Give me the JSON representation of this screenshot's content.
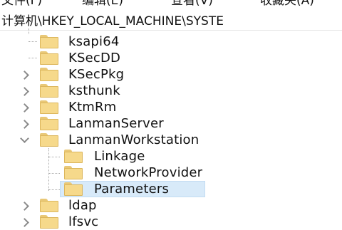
{
  "menubar": {
    "items": [
      "文件(F)",
      "编辑(E)",
      "查看(V)",
      "收藏夹(A)"
    ]
  },
  "address": {
    "path": "计算机\\HKEY_LOCAL_MACHINE\\SYSTE"
  },
  "tree": {
    "items": [
      {
        "label": "ksapi64",
        "expander": "none",
        "level": 1,
        "selected": false
      },
      {
        "label": "KSecDD",
        "expander": "none",
        "level": 1,
        "selected": false
      },
      {
        "label": "KSecPkg",
        "expander": "right",
        "level": 1,
        "selected": false
      },
      {
        "label": "ksthunk",
        "expander": "right",
        "level": 1,
        "selected": false
      },
      {
        "label": "KtmRm",
        "expander": "right",
        "level": 1,
        "selected": false
      },
      {
        "label": "LanmanServer",
        "expander": "right",
        "level": 1,
        "selected": false
      },
      {
        "label": "LanmanWorkstation",
        "expander": "down",
        "level": 1,
        "selected": false
      },
      {
        "label": "Linkage",
        "expander": "none",
        "level": 2,
        "selected": false
      },
      {
        "label": "NetworkProvider",
        "expander": "none",
        "level": 2,
        "selected": false
      },
      {
        "label": "Parameters",
        "expander": "none",
        "level": 2,
        "selected": true
      },
      {
        "label": "ldap",
        "expander": "right",
        "level": 1,
        "selected": false
      },
      {
        "label": "lfsvc",
        "expander": "right",
        "level": 1,
        "selected": false
      }
    ]
  },
  "colors": {
    "folder": "#f6d98b",
    "selection": "#d8eaf9"
  }
}
